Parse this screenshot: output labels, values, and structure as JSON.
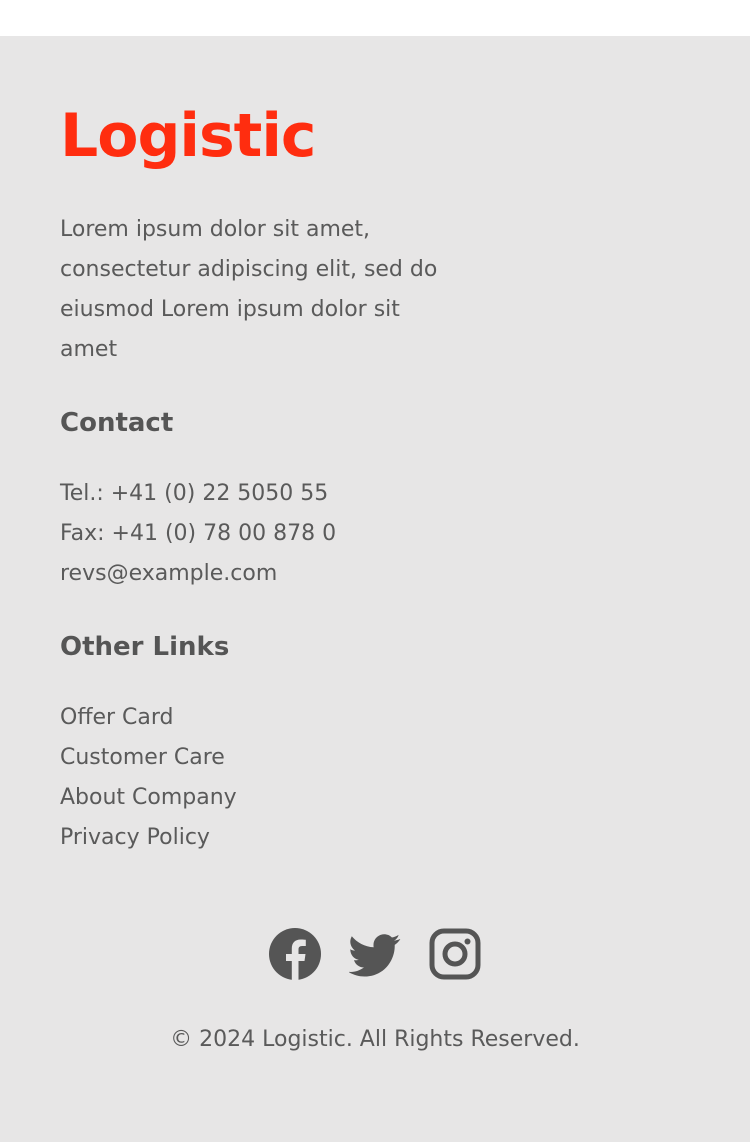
{
  "brand": {
    "name": "Logistic",
    "color": "#ff2d0f"
  },
  "about": {
    "text": "Lorem ipsum dolor sit amet, consectetur adipiscing elit, sed do eiusmod Lorem ipsum dolor sit amet"
  },
  "contact": {
    "heading": "Contact",
    "phone": "Tel.: +41 (0) 22 5050 55",
    "fax": "Fax: +41 (0) 78 00 878 0",
    "email": "revs@example.com"
  },
  "other_links": {
    "heading": "Other Links",
    "items": [
      {
        "label": "Offer Card"
      },
      {
        "label": "Customer Care"
      },
      {
        "label": "About Company"
      },
      {
        "label": "Privacy Policy"
      }
    ]
  },
  "social": {
    "icons": [
      "facebook-icon",
      "twitter-icon",
      "instagram-icon"
    ],
    "icon_color": "#555555"
  },
  "copyright": "© 2024 Logistic. All Rights Reserved.",
  "colors": {
    "footer_background": "#e7e6e6",
    "text": "#5a5a5a"
  }
}
